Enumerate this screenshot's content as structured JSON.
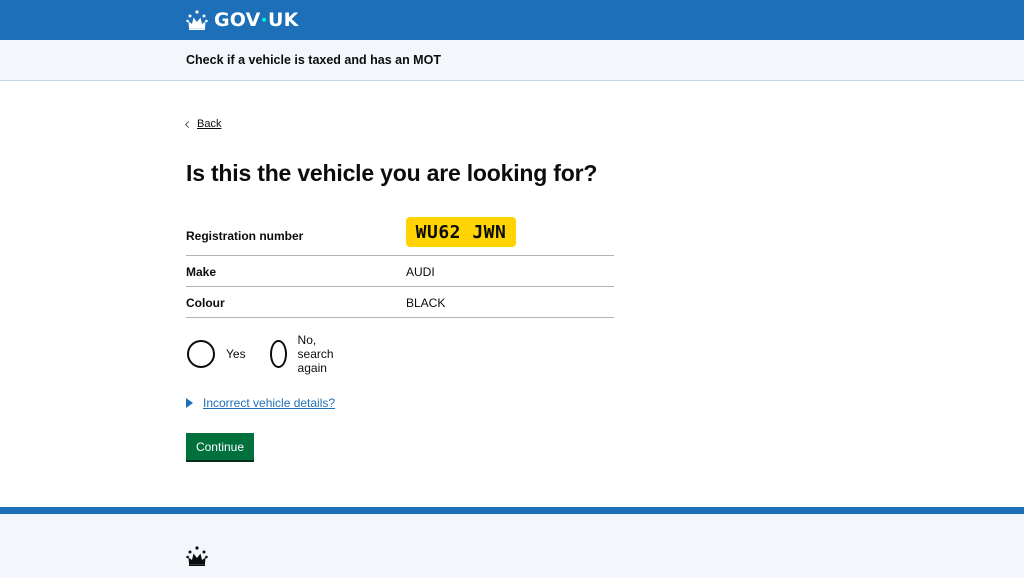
{
  "header": {
    "logo_text_left": "GOV",
    "logo_dot": "·",
    "logo_text_right": "UK",
    "crown_icon": "crown-icon",
    "background": "#1d70b8"
  },
  "service": {
    "name": "Check if a vehicle is taxed and has an MOT"
  },
  "back_link": {
    "label": "Back",
    "icon": "chevron-left-icon"
  },
  "main": {
    "heading": "Is this the vehicle you are looking for?"
  },
  "summary": {
    "rows": [
      {
        "key": "Registration number",
        "value": "WU62 JWN"
      },
      {
        "key": "Make",
        "value": "AUDI"
      },
      {
        "key": "Colour",
        "value": "BLACK"
      }
    ],
    "plate_color": "#ffd400"
  },
  "radios": {
    "options": [
      {
        "label": "Yes",
        "selected": false
      },
      {
        "label": "No, search again",
        "selected": false
      }
    ]
  },
  "details": {
    "summary": "Incorrect vehicle details?",
    "icon": "triangle-right-icon",
    "expanded": false
  },
  "continue_button": {
    "label": "Continue",
    "color": "#00703c"
  },
  "footer": {
    "crown_icon": "crown-icon",
    "border_color": "#1d70b8"
  }
}
